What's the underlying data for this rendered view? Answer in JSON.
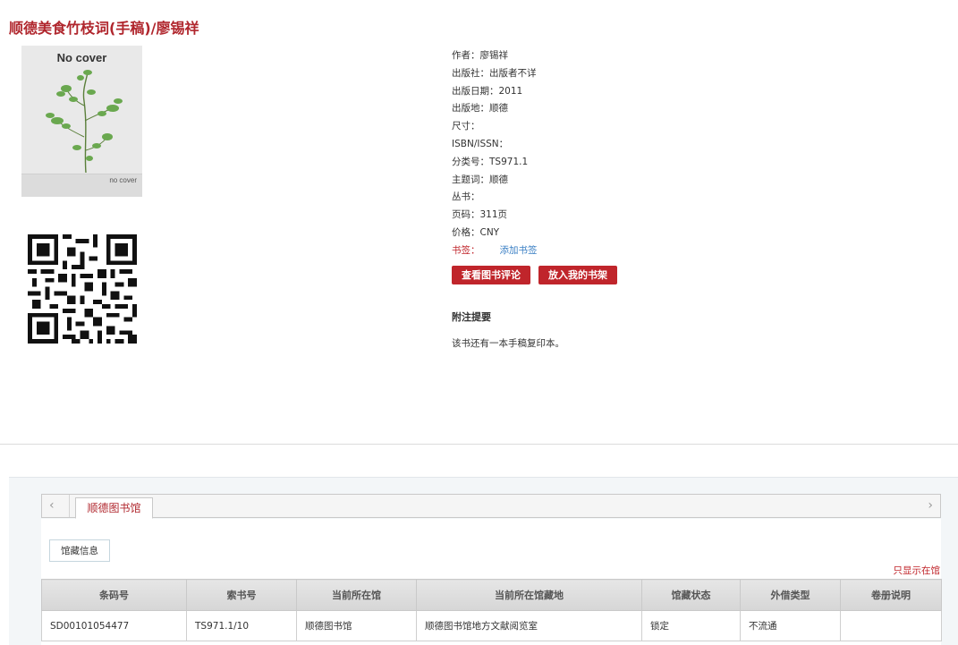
{
  "book": {
    "title": "顺德美食竹枝词(手稿)/廖锡祥",
    "cover_title": "No cover",
    "cover_small": "no cover"
  },
  "meta_rows": [
    "作者：廖锡祥",
    "出版社：出版者不详",
    "出版日期：2011",
    "出版地：顺德",
    "尺寸：",
    "ISBN/ISSN：",
    "分类号：TS971.1",
    "主题词：顺德",
    "丛书：",
    "页码：311页",
    "价格：CNY"
  ],
  "tag_row": {
    "label": "书签：",
    "link": "添加书签"
  },
  "buttons": {
    "review": "查看图书评论",
    "shelf": "放入我的书架"
  },
  "notes": {
    "heading": "附注提要",
    "text": "该书还有一本手稿复印本。"
  },
  "holdings": {
    "library_tab": "顺德图书馆",
    "sub_tab": "馆藏信息",
    "only_show": "只显示在馆",
    "columns": [
      "条码号",
      "索书号",
      "当前所在馆",
      "当前所在馆藏地",
      "馆藏状态",
      "外借类型",
      "卷册说明"
    ],
    "rows": [
      [
        "SD00101054477",
        "TS971.1/10",
        "顺德图书馆",
        "顺德图书馆地方文献阅览室",
        "锁定",
        "不流通",
        ""
      ]
    ]
  },
  "icons": {
    "left": "chevron-left-icon",
    "right": "chevron-right-icon"
  },
  "colors": {
    "accent": "#c0252b",
    "link": "#3a7fc4"
  }
}
